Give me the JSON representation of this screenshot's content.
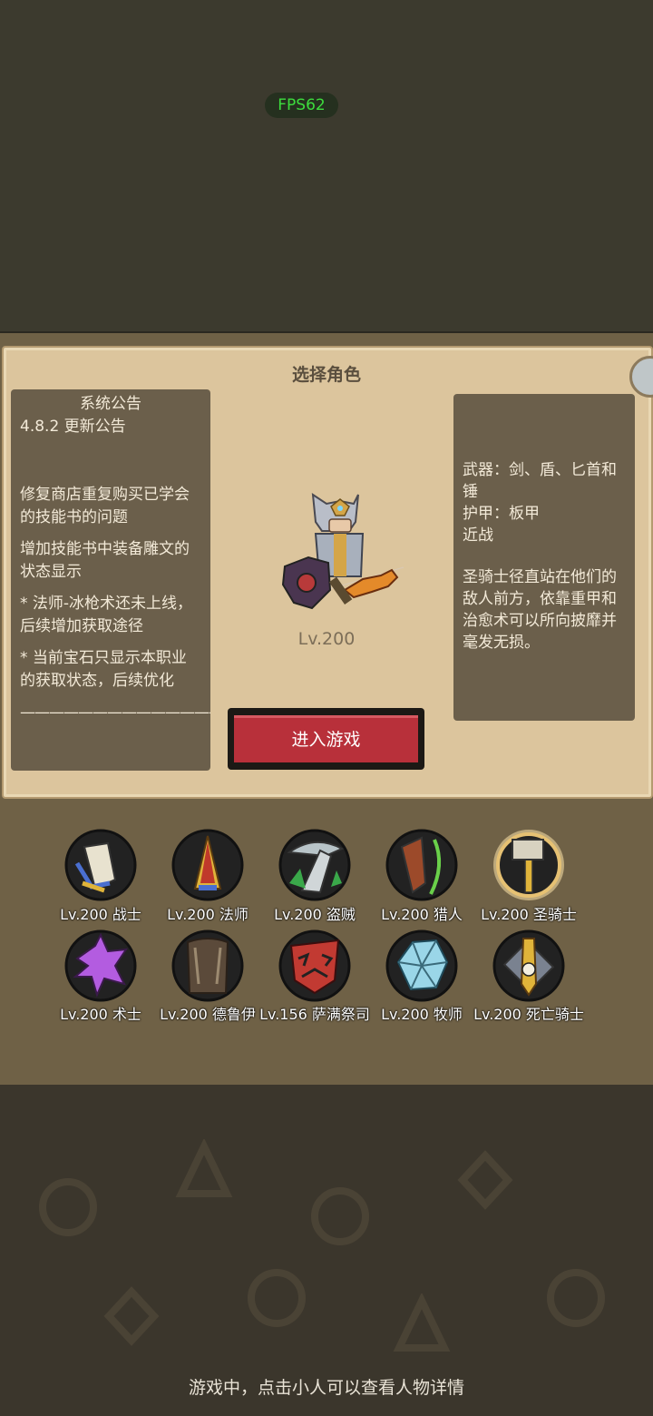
{
  "status": {
    "fps": "FPS62"
  },
  "panel": {
    "title": "选择角色"
  },
  "notice": {
    "title": "系统公告",
    "version": "4.8.2 更新公告",
    "items": [
      "修复商店重复购买已学会的技能书的问题",
      "增加技能书中装备雕文的状态显示",
      "* 法师-冰枪术还未上线，后续增加获取途径",
      "* 当前宝石只显示本职业的获取状态，后续优化"
    ],
    "divider": "——————————————"
  },
  "selected": {
    "level": "Lv.200",
    "weapon": "武器：剑、盾、匕首和锤",
    "armor": "护甲：板甲",
    "range": "近战",
    "description": "圣骑士径直站在他们的敌人前方，依靠重甲和治愈术可以所向披靡并毫发无损。"
  },
  "enter_button": "进入游戏",
  "classes": [
    {
      "label": "Lv.200 战士",
      "icon": "warrior-icon",
      "color": "#e8e2cf"
    },
    {
      "label": "Lv.200 法师",
      "icon": "mage-icon",
      "color": "#c0392b"
    },
    {
      "label": "Lv.200 盗贼",
      "icon": "rogue-icon",
      "color": "#b8c4c8"
    },
    {
      "label": "Lv.200 猎人",
      "icon": "hunter-icon",
      "color": "#9c4a2a"
    },
    {
      "label": "Lv.200 圣骑士",
      "icon": "paladin-icon",
      "color": "#d8d2c0",
      "selected": true
    },
    {
      "label": "Lv.200 术士",
      "icon": "warlock-icon",
      "color": "#b35ce0"
    },
    {
      "label": "Lv.200 德鲁伊",
      "icon": "druid-icon",
      "color": "#5b4a3a"
    },
    {
      "label": "Lv.156 萨满祭司",
      "icon": "shaman-icon",
      "color": "#c23a32"
    },
    {
      "label": "Lv.200 牧师",
      "icon": "priest-icon",
      "color": "#9ad6e8"
    },
    {
      "label": "Lv.200 死亡骑士",
      "icon": "death-knight-icon",
      "color": "#e0b43a"
    }
  ],
  "hint": "游戏中，点击小人可以查看人物详情"
}
